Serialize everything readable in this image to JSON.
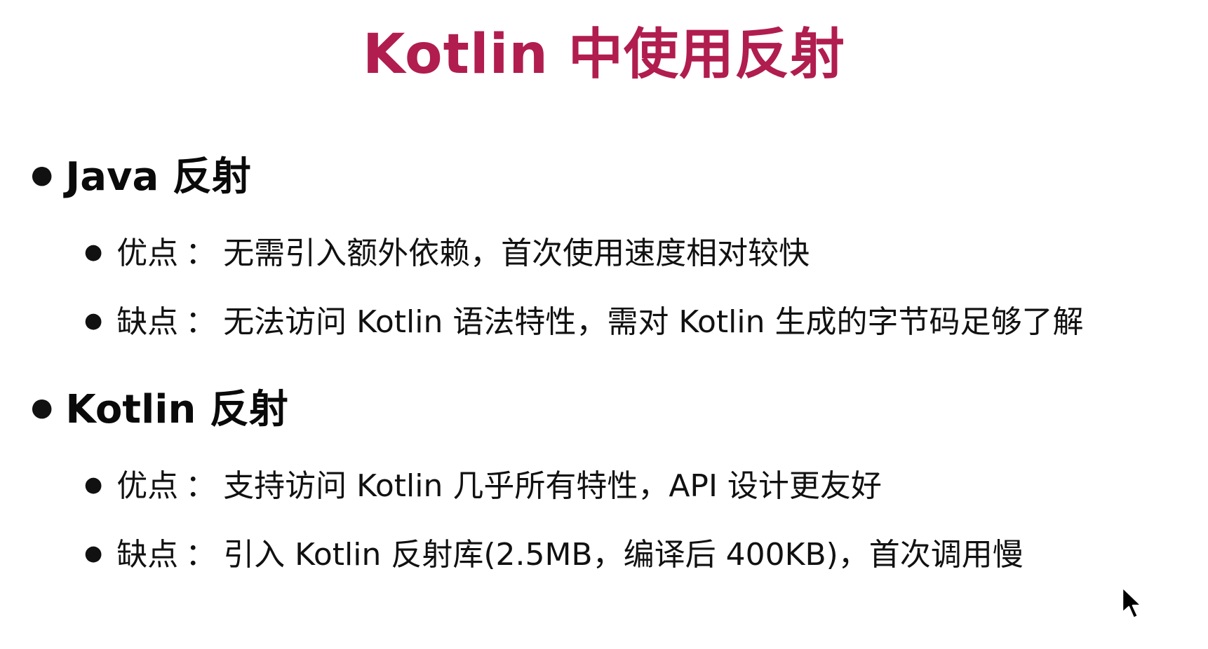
{
  "title": "Kotlin 中使用反射",
  "sections": [
    {
      "heading": "Java 反射",
      "items": [
        {
          "label": "优点",
          "sep": "：",
          "text": "无需引入额外依赖，首次使用速度相对较快"
        },
        {
          "label": "缺点",
          "sep": "：",
          "text": "无法访问 Kotlin 语法特性，需对 Kotlin 生成的字节码足够了解"
        }
      ]
    },
    {
      "heading": "Kotlin 反射",
      "items": [
        {
          "label": "优点",
          "sep": "：",
          "text": "支持访问 Kotlin 几乎所有特性，API 设计更友好"
        },
        {
          "label": "缺点",
          "sep": "：",
          "text": "引入 Kotlin 反射库(2.5MB，编译后 400KB)，首次调用慢"
        }
      ]
    }
  ],
  "colors": {
    "title": "#b01d4e",
    "text": "#111111",
    "background": "#ffffff"
  },
  "icons": {
    "bullet": "bullet-dot",
    "cursor": "mouse-pointer-icon"
  }
}
